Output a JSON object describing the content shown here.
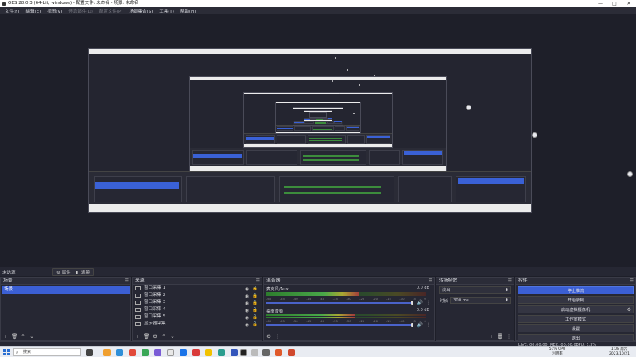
{
  "window": {
    "title": "OBS 28.0.3 (64-bit, windows) - 配置文件: 未命名 - 场景: 未命名",
    "controls": [
      "—",
      "□",
      "✕"
    ]
  },
  "menu": [
    {
      "label": "文件(F)",
      "enabled": true
    },
    {
      "label": "编辑(E)",
      "enabled": true
    },
    {
      "label": "视图(V)",
      "enabled": true
    },
    {
      "label": "停靠部件(D)",
      "enabled": false
    },
    {
      "label": "配置文件(P)",
      "enabled": false
    },
    {
      "label": "场景集合(S)",
      "enabled": true
    },
    {
      "label": "工具(T)",
      "enabled": true
    },
    {
      "label": "帮助(H)",
      "enabled": true
    }
  ],
  "tabbar": {
    "current_scene": "未选源",
    "properties": "属性",
    "filters": "滤镜"
  },
  "scenes": {
    "title": "场景",
    "items": [
      "场景"
    ]
  },
  "sources": {
    "title": "来源",
    "items": [
      "窗口采集 1",
      "窗口采集 2",
      "窗口采集 3",
      "窗口采集 4",
      "窗口采集 5",
      "显示器采集"
    ]
  },
  "mixer": {
    "title": "混音器",
    "channels": [
      {
        "name": "麦克风/Aux",
        "db": "0.0 dB",
        "level": 0.58
      },
      {
        "name": "桌面音频",
        "db": "0.0 dB",
        "level": 0.55
      }
    ],
    "ticks": [
      "-60",
      "-55",
      "-50",
      "-45",
      "-40",
      "-35",
      "-30",
      "-25",
      "-20",
      "-15",
      "-10",
      "-5",
      "0"
    ]
  },
  "transitions": {
    "title": "转场特效",
    "selected": "淡出",
    "duration_label": "时长",
    "duration": "300 ms"
  },
  "controls": {
    "title": "控件",
    "buttons": [
      "停止推流",
      "开始录制",
      "启动虚拟摄像机",
      "工作室模式",
      "设置",
      "退出"
    ]
  },
  "status": {
    "live": "LIVE: 00:00:00",
    "rec": "REC: 00:00:00",
    "cpu": "CPU: 1.3%"
  },
  "taskbar": {
    "search_placeholder": "搜索",
    "tray_text": "51% CPU利用率",
    "time": "1:08 周六",
    "date": "2023/10/21"
  },
  "colors": {
    "accent": "#3b5fd4",
    "window_bg": "#1e1f29",
    "panel_bg": "#262733"
  }
}
